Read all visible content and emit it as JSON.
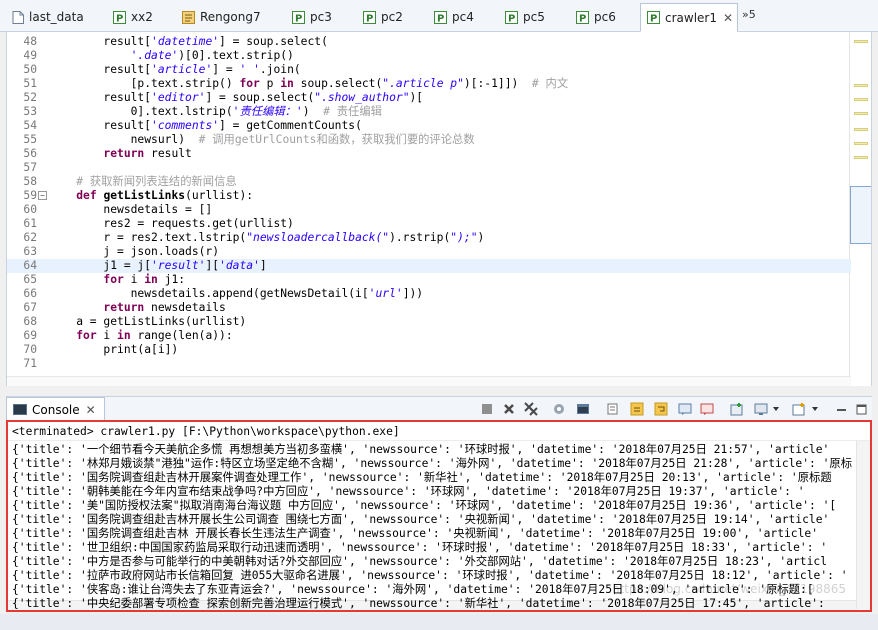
{
  "tabs": [
    {
      "label": "last_data",
      "icon": "file-icon",
      "active": false
    },
    {
      "label": "xx2",
      "icon": "python-module-icon",
      "active": false
    },
    {
      "label": "Rengong7",
      "icon": "notebook-icon",
      "active": false
    },
    {
      "label": "pc3",
      "icon": "python-module-icon",
      "active": false
    },
    {
      "label": "pc2",
      "icon": "python-module-icon",
      "active": false
    },
    {
      "label": "pc4",
      "icon": "python-module-icon",
      "active": false
    },
    {
      "label": "pc5",
      "icon": "python-module-icon",
      "active": false
    },
    {
      "label": "pc6",
      "icon": "python-module-icon",
      "active": false
    },
    {
      "label": "crawler1",
      "icon": "python-module-icon",
      "active": true
    }
  ],
  "tab_close_glyph": "✕",
  "tab_overflow": "»5",
  "editor": {
    "lines": [
      {
        "n": "48",
        "html": "        result[<span class=\"str\">'datetime'</span>] = soup.select("
      },
      {
        "n": "49",
        "html": "            <span class=\"str\">'.date'</span>)[0].text.strip()"
      },
      {
        "n": "50",
        "html": "        result[<span class=\"str\">'article'</span>] = <span class=\"str\">' '</span>.join("
      },
      {
        "n": "51",
        "html": "            [p.text.strip() <span class=\"kw\">for</span> p <span class=\"kw\">in</span> soup.select(<span class=\"str\">\".article p\"</span>)[:-1]])  <span class=\"cm\"># 内文</span>"
      },
      {
        "n": "52",
        "html": "        result[<span class=\"str\">'editor'</span>] = soup.select(<span class=\"str\">\".show_author\"</span>)["
      },
      {
        "n": "53",
        "html": "            0].text.lstrip(<span class=\"str\">'责任编辑：'</span>)  <span class=\"cm\"># 责任编辑</span>"
      },
      {
        "n": "54",
        "html": "        result[<span class=\"str\">'comments'</span>] = getCommentCounts("
      },
      {
        "n": "55",
        "html": "            newsurl)  <span class=\"cm\"># 调用getUrlCounts和函数，获取我们要的评论总数</span>"
      },
      {
        "n": "56",
        "html": "        <span class=\"kw\">return</span> result"
      },
      {
        "n": "57",
        "html": ""
      },
      {
        "n": "58",
        "html": "    <span class=\"cm\"># 获取新闻列表连结的新闻信息</span>"
      },
      {
        "n": "59",
        "html": "    <span class=\"kw\">def</span> <b>getListLinks</b>(urllist):"
      },
      {
        "n": "60",
        "html": "        newsdetails = []"
      },
      {
        "n": "61",
        "html": "        res2 = requests.get(urllist)"
      },
      {
        "n": "62",
        "html": "        r = res2.text.lstrip(<span class=\"str\">\"newsloadercallback(\"</span>).rstrip(<span class=\"str\">\");\"</span>)"
      },
      {
        "n": "63",
        "html": "        j = json.loads(r)"
      },
      {
        "n": "64",
        "html": "        j1 = j[<span class=\"str\">'result'</span>][<span class=\"str\">'data'</span>]"
      },
      {
        "n": "65",
        "html": "        <span class=\"kw\">for</span> i <span class=\"kw\">in</span> j1:"
      },
      {
        "n": "66",
        "html": "            newsdetails.append(getNewsDetail(i[<span class=\"str\">'url'</span>]))"
      },
      {
        "n": "67",
        "html": "        <span class=\"kw\">return</span> newsdetails"
      },
      {
        "n": "68",
        "html": "    a = getListLinks(urllist)"
      },
      {
        "n": "69",
        "html": "    <span class=\"kw\">for</span> i <span class=\"kw\">in</span> range(len(a)):"
      },
      {
        "n": "70",
        "html": "        print(a[i])"
      },
      {
        "n": "71",
        "html": ""
      }
    ],
    "current_line": "64",
    "fold_line": "59",
    "fold_glyph": "⊖"
  },
  "console": {
    "tab_label": "Console",
    "terminated": "<terminated> crawler1.py [F:\\Python\\workspace\\python.exe]",
    "output": [
      "{'title': '一个细节看今天美航企多慌 再想想美方当初多蛮横', 'newssource': '环球时报', 'datetime': '2018年07月25日 21:57', 'article'",
      "{'title': '林郑月娥谈禁\"港独\"运作:特区立场坚定绝不含糊', 'newssource': '海外网', 'datetime': '2018年07月25日 21:28', 'article': '原标",
      "{'title': '国务院调查组赴吉林开展案件调查处理工作', 'newssource': '新华社', 'datetime': '2018年07月25日 20:13', 'article': '原标题",
      "{'title': '朝韩美能在今年内宣布结束战争吗?中方回应', 'newssource': '环球网', 'datetime': '2018年07月25日 19:37', 'article': '",
      "{'title': '美\"国防授权法案\"拟取消南海台海议题 中方回应', 'newssource': '环球网', 'datetime': '2018年07月25日 19:36', 'article': '[",
      "{'title': '国务院调查组赴吉林开展长生公司调查 围绕七方面', 'newssource': '央视新闻', 'datetime': '2018年07月25日 19:14', 'article'",
      "{'title': '国务院调查组赴吉林 开展长春长生违法生产调查', 'newssource': '央视新闻', 'datetime': '2018年07月25日 19:00', 'article'",
      "{'title': '世卫组织:中国国家药监局采取行动迅速而透明', 'newssource': '环球时报', 'datetime': '2018年07月25日 18:33', 'article': '",
      "{'title': '中方是否参与可能举行的中美朝韩对话?外交部回应', 'newssource': '外交部网站', 'datetime': '2018年07月25日 18:23', 'articl",
      "{'title': '拉萨市政府网站市长信箱回复 进055大驱命名进展', 'newssource': '环球时报', 'datetime': '2018年07月25日 18:12', 'article': '",
      "{'title': '侠客岛:谁让台湾失去了东亚青运会?', 'newssource': '海外网', 'datetime': '2018年07月25日 18:09', 'article': '原标题:[",
      "{'title': '中央纪委部署专项检查 探索创新完善治理运行模式', 'newssource': '新华社', 'datetime': '2018年07月25日 17:45', 'article':"
    ],
    "watermark": "https://blog.csdn.net/weixin_42198865"
  },
  "colors": {
    "keyword": "#7f0055",
    "string": "#2a00ff",
    "comment": "#a0a0a0",
    "highlight_border": "#e53935",
    "current_line": "#e8f2fe"
  }
}
